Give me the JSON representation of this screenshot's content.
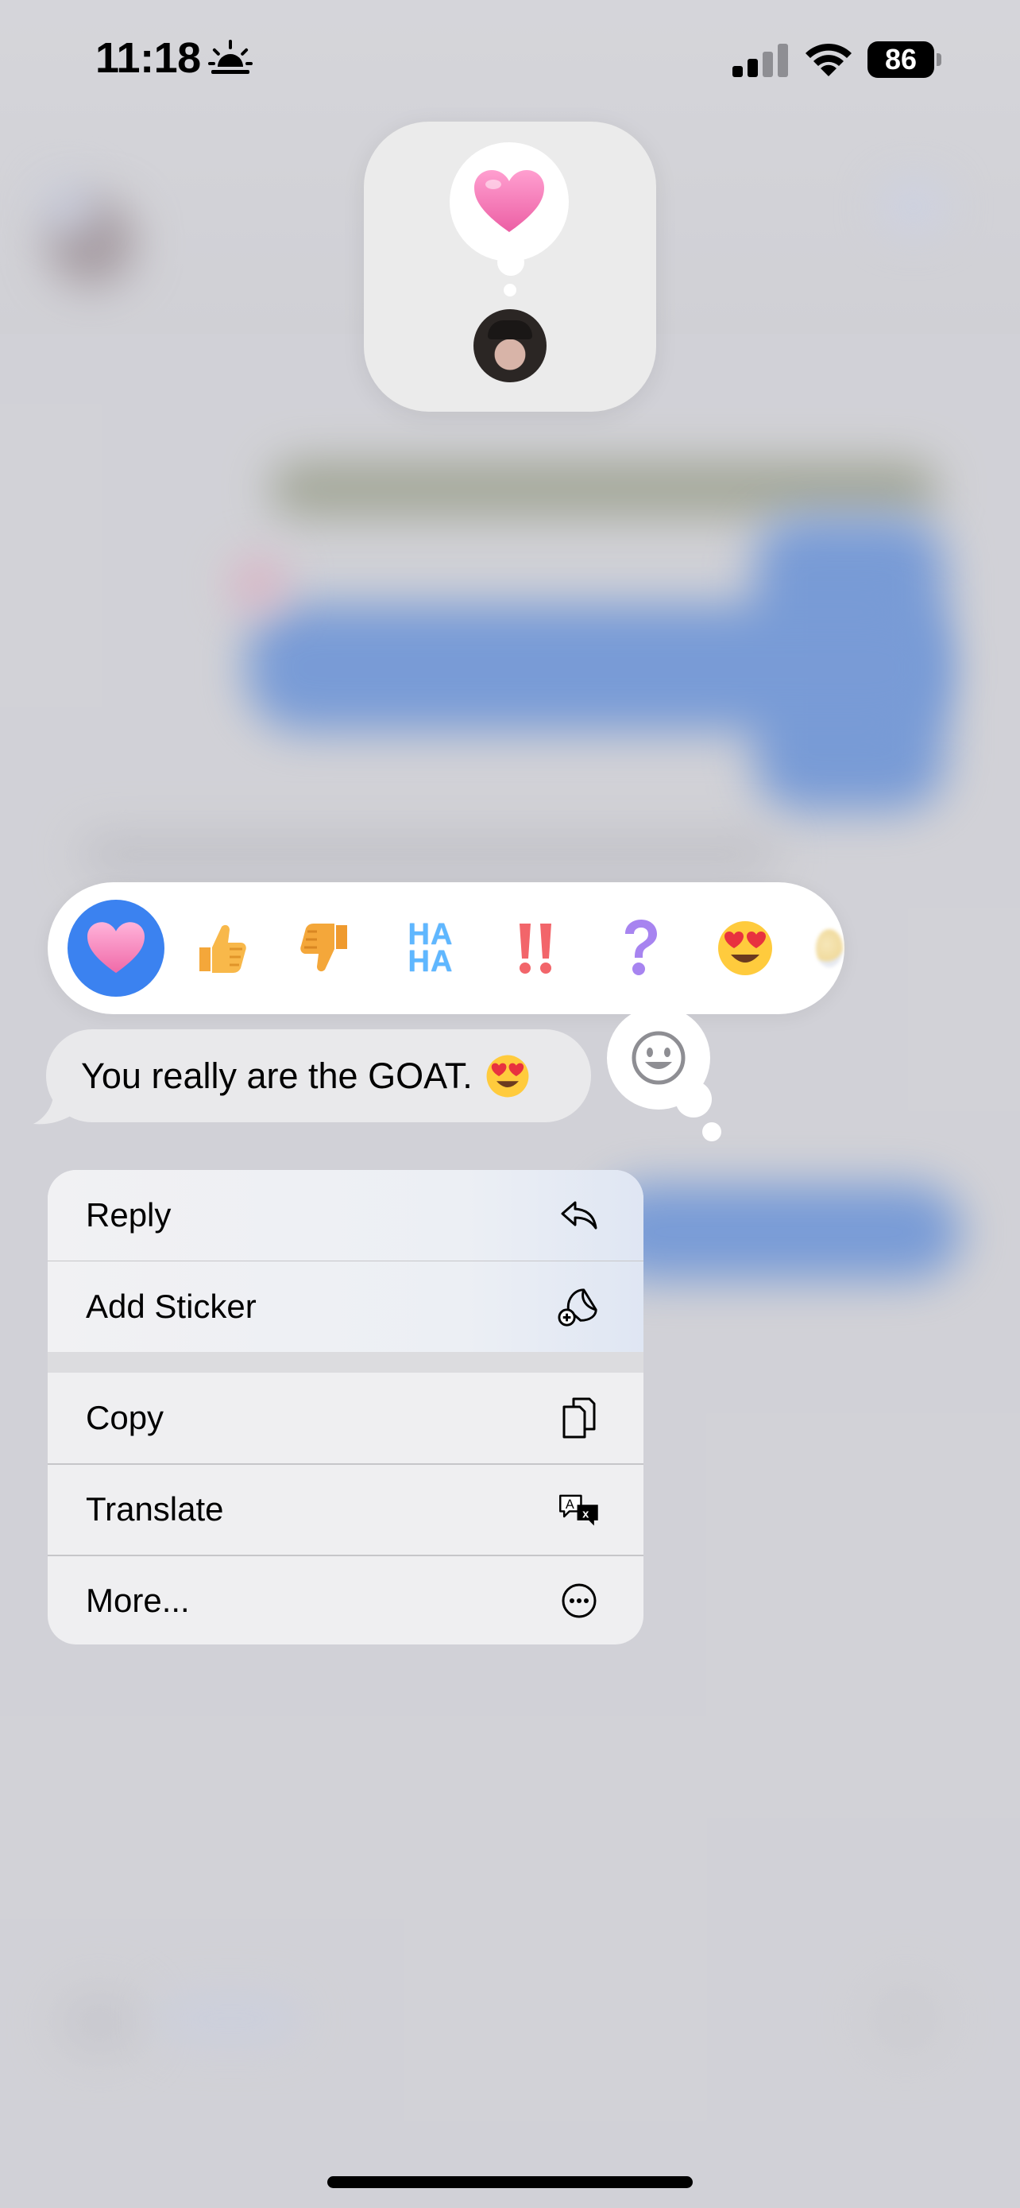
{
  "status_bar": {
    "time": "11:18",
    "time_icon": "sunrise-icon",
    "battery_level": "86",
    "icons": [
      "signal-icon",
      "wifi-icon",
      "battery-icon"
    ]
  },
  "reaction_summary": {
    "reaction": "heart",
    "reactor": "contact-avatar"
  },
  "tapbacks": [
    {
      "name": "heart",
      "selected": true
    },
    {
      "name": "thumbs-up",
      "selected": false
    },
    {
      "name": "thumbs-down",
      "selected": false
    },
    {
      "name": "haha",
      "label": "HA HA",
      "selected": false
    },
    {
      "name": "exclamation",
      "selected": false
    },
    {
      "name": "question",
      "selected": false
    },
    {
      "name": "heart-eyes-emoji",
      "selected": false
    },
    {
      "name": "more-emoji",
      "selected": false
    }
  ],
  "message": {
    "text": "You really are the GOAT.",
    "emoji": "heart-eyes-emoji"
  },
  "emoji_picker_icon": "smiley-icon",
  "menu": {
    "items": [
      {
        "label": "Reply",
        "icon": "reply-arrow-icon"
      },
      {
        "label": "Add Sticker",
        "icon": "add-sticker-icon"
      },
      {
        "label": "Copy",
        "icon": "copy-icon"
      },
      {
        "label": "Translate",
        "icon": "translate-icon"
      },
      {
        "label": "More...",
        "icon": "ellipsis-circle-icon"
      }
    ]
  },
  "colors": {
    "accent_blue": "#3b82f0",
    "heart_pink": "#f06aa8",
    "bubble_gray": "#e9e9eb",
    "menu_bg": "#efeff1"
  }
}
